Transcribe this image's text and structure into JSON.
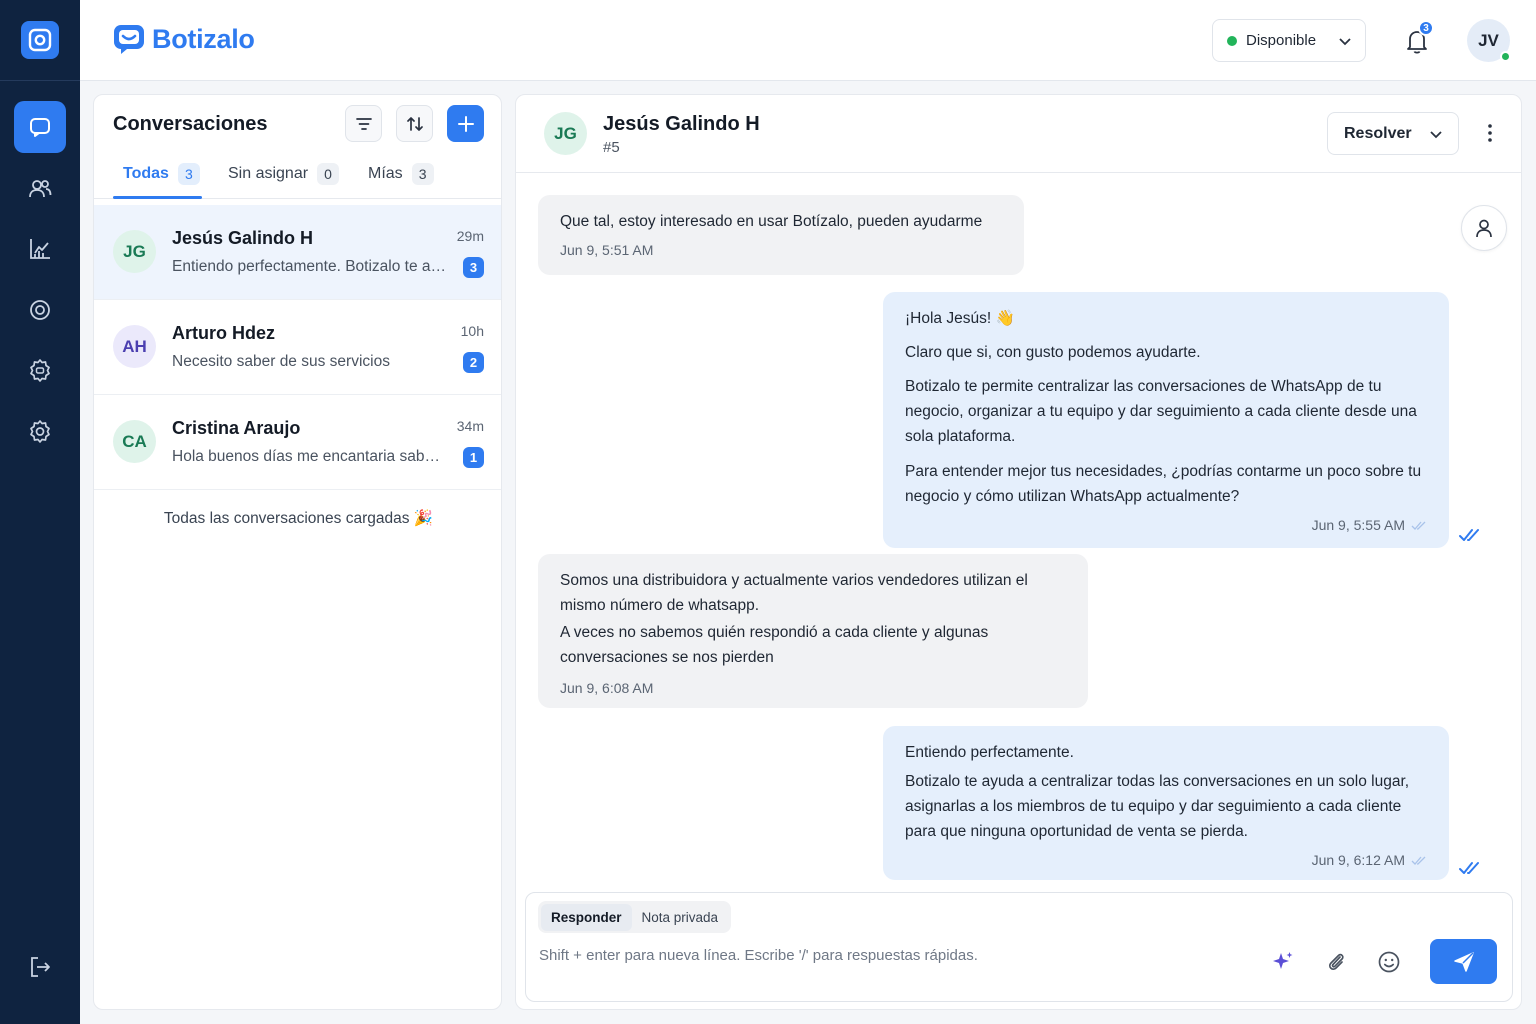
{
  "brand": {
    "name": "Botizalo"
  },
  "colors": {
    "accent": "#2f7bf0",
    "sidebar": "#0f2340",
    "online": "#22b45a"
  },
  "sidebar": {
    "items": [
      {
        "icon": "chat-icon",
        "active": true
      },
      {
        "icon": "users-icon",
        "active": false
      },
      {
        "icon": "chart-icon",
        "active": false
      },
      {
        "icon": "target-icon",
        "active": false
      },
      {
        "icon": "bot-settings-icon",
        "active": false
      },
      {
        "icon": "gear-icon",
        "active": false
      }
    ],
    "logout_icon": "logout-icon"
  },
  "topbar": {
    "status": "Disponible",
    "notifications_count": "3",
    "user_initials": "JV"
  },
  "conversations": {
    "title": "Conversaciones",
    "tabs": [
      {
        "label": "Todas",
        "count": "3"
      },
      {
        "label": "Sin asignar",
        "count": "0"
      },
      {
        "label": "Mías",
        "count": "3"
      }
    ],
    "items": [
      {
        "initials": "JG",
        "name": "Jesús Galindo H",
        "preview": "Entiendo perfectamente. Botizalo te ayuda a centralizar todas las conversaciones",
        "time": "29m",
        "unread": "3"
      },
      {
        "initials": "AH",
        "name": "Arturo Hdez",
        "preview": "Necesito saber de sus servicios",
        "time": "10h",
        "unread": "2"
      },
      {
        "initials": "CA",
        "name": "Cristina Araujo",
        "preview": "Hola buenos días me encantaria saber más",
        "time": "34m",
        "unread": "1"
      }
    ],
    "loaded_message": "Todas las conversaciones cargadas 🎉"
  },
  "chat": {
    "initials": "JG",
    "name": "Jesús Galindo H",
    "id": "#5",
    "resolve_label": "Resolver",
    "messages": [
      {
        "paragraphs": [
          "Que tal, estoy interesado en usar Botízalo, pueden ayudarme"
        ],
        "time": "Jun 9, 5:51 AM"
      },
      {
        "paragraphs": [
          "¡Hola Jesús! 👋",
          "Claro que si, con gusto podemos ayudarte.",
          "Botizalo te permite centralizar las conversaciones de WhatsApp de tu negocio, organizar a tu equipo y dar seguimiento a cada cliente desde una sola plataforma.",
          "Para entender mejor tus necesidades, ¿podrías contarme un poco sobre tu negocio y cómo utilizan WhatsApp actualmente?"
        ],
        "time": "Jun 9, 5:55 AM"
      },
      {
        "paragraphs": [
          "Somos una distribuidora y actualmente varios vendedores utilizan el mismo número de whatsapp.",
          "A veces no sabemos quién respondió a cada cliente y algunas conversaciones se nos pierden"
        ],
        "time": "Jun 9, 6:08 AM"
      },
      {
        "paragraphs": [
          "Entiendo perfectamente.",
          "Botizalo te ayuda a centralizar todas las conversaciones en un solo lugar, asignarlas a los miembros de tu equipo y dar seguimiento a cada cliente para que ninguna oportunidad de venta se pierda."
        ],
        "time": "Jun 9, 6:12 AM"
      }
    ]
  },
  "composer": {
    "mode_reply": "Responder",
    "mode_note": "Nota privada",
    "placeholder": "Shift + enter para nueva línea. Escribe '/' para respuestas rápidas."
  }
}
